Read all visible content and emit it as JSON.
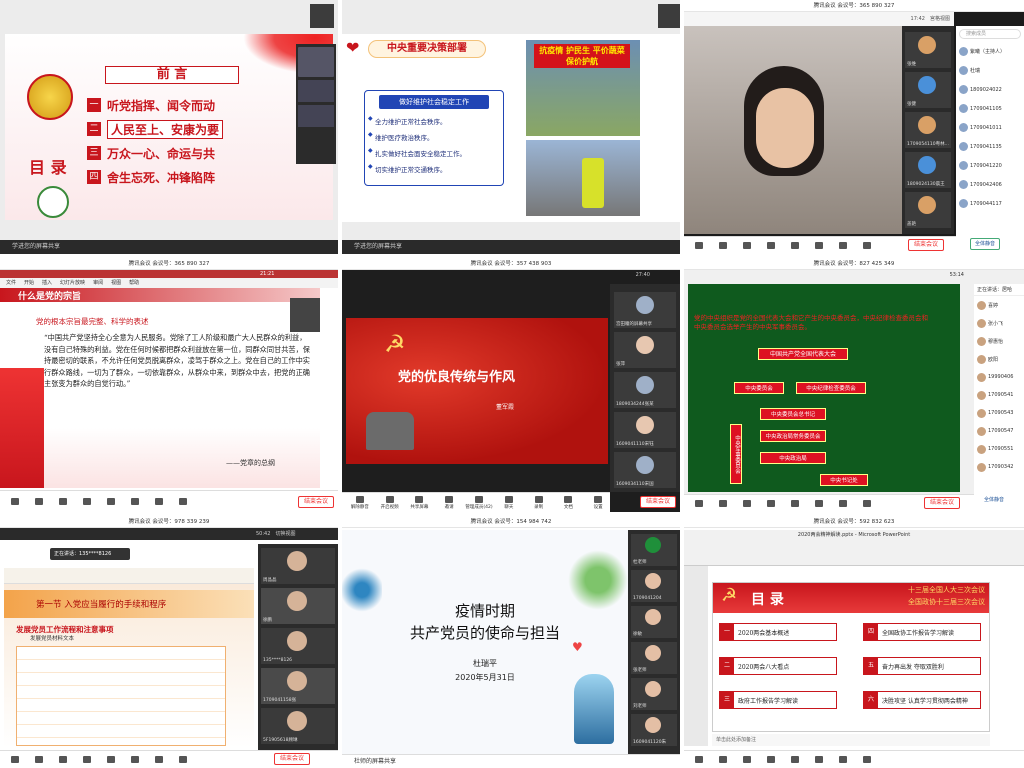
{
  "p1": {
    "heading": "前  言",
    "label": "目 录",
    "items": [
      {
        "num": "一",
        "text": "听党指挥、闻令而动"
      },
      {
        "num": "二",
        "text": "人民至上、安康为要"
      },
      {
        "num": "三",
        "text": "万众一心、命运与共"
      },
      {
        "num": "四",
        "text": "舍生忘死、冲锋陷阵"
      }
    ],
    "footer": "学进您的屏幕共享"
  },
  "p2": {
    "title": "中央重要决策部署",
    "box_title": "做好维护社会稳定工作",
    "items": [
      "全力维护正常社会秩序。",
      "维护医疗救治秩序。",
      "扎实做好社会面安全稳定工作。",
      "切实维护正常交通秩序。"
    ],
    "photo_text": "抗疫情 护民生 平价蔬菜 保价护航",
    "footer": "学进您的屏幕共享"
  },
  "p3": {
    "header": "腾讯会议 会议号：365 890 327",
    "time": "17:42",
    "view_label": "宫格视图",
    "search": "搜索成员",
    "participants": [
      "张维",
      "张健",
      "1709054110粤林...",
      "1809024130晨王",
      "盖艳"
    ],
    "list": [
      "紫曦（主持人）",
      "杜瑞",
      "1809024022",
      "1709041105",
      "1709041011",
      "1709041135",
      "1709041220",
      "1709042406",
      "1709044117"
    ],
    "leave": "结束会议",
    "invite": "全体静音"
  },
  "p4": {
    "header": "腾讯会议 会议号：365 890 327",
    "time": "21:21",
    "title": "什么是党的宗旨",
    "subtitle": "党的根本宗旨最完整、科学的表述",
    "quote": "“中国共产党坚持全心全意为人民服务。党除了工人阶级和最广大人民群众的利益，没有自己特殊的利益。党在任何时候都把群众利益放在第一位，同群众同甘共苦，保持最密切的联系，不允许任何党员脱离群众，凌驾于群众之上。党在自己的工作中实行群众路线，一切为了群众，一切依靠群众，从群众中来，到群众中去，把党的正确主张变为群众的自觉行动。”",
    "source": "——党章的总纲",
    "leave": "结束会议",
    "tabs": [
      "文件",
      "开始",
      "插入",
      "幻灯片放映",
      "审阅",
      "视图",
      "帮助"
    ]
  },
  "p5": {
    "header": "腾讯会议 会议号：357 438 903",
    "time": "27:40",
    "title": "党的优良传统与作风",
    "presenter": "董军霞",
    "participants": [
      "宫田瞳的屏幕共享",
      "张萍",
      "1809034244张某",
      "1609041110宋钰",
      "1609034110宋国"
    ],
    "leave": "结束会议",
    "tools": [
      "解除静音",
      "开启视频",
      "共享屏幕",
      "邀请",
      "管理成员(42)",
      "聊天",
      "录制",
      "文档",
      "设置"
    ]
  },
  "p6": {
    "header": "腾讯会议 会议号：827 425 349",
    "time": "53:14",
    "intro": "党的中央组织是党的全国代表大会和它产生的中央委员会，中央纪律检查委员会和中央委员会选举产生的中央军事委员会。",
    "top": "中国共产党全国代表大会",
    "mid": [
      "中央委员会",
      "中央纪律检查委员会"
    ],
    "chain": [
      "中央委员会总书记",
      "中央政治局常务委员会",
      "中央政治局",
      "中央书记处"
    ],
    "side": "中央军事委员会",
    "speaker": "正在讲话：居哈",
    "list": [
      "喜婷",
      "张小飞",
      "穆惠怡",
      "欧阳",
      "19990406",
      "17090541",
      "17090543",
      "17090547",
      "17090551",
      "17090342"
    ],
    "leave": "结束会议",
    "invite": "全体静音"
  },
  "p7": {
    "header": "腾讯会议 会议号：978 339 239",
    "time": "50:42",
    "speaker": "正在讲话：135****8126",
    "section": "第一节  入党应当履行的手续和程序",
    "sub": "发展党员工作流程和注意事项",
    "sub2": "发展党员材料文本",
    "participants": [
      "周晶晶",
      "徐鹏",
      "135****8126",
      "1709041158张",
      "5F1905618顾琳"
    ],
    "leave": "结束会议",
    "view": "切换视图"
  },
  "p8": {
    "header": "腾讯会议 会议号：154 984 742",
    "title1": "疫情时期",
    "title2": "共产党员的使命与担当",
    "author": "杜瑞平",
    "date": "2020年5月31日",
    "participants": [
      "杜老师",
      "1709041204",
      "徐敏",
      "张老师",
      "刘老师",
      "1609041120朱"
    ],
    "footer": "杜师的屏幕共享",
    "tag": "老师"
  },
  "p9": {
    "header": "腾讯会议 会议号：592 832 623",
    "app": "2020两会精神解读.pptx - Microsoft PowerPoint",
    "title": "目 录",
    "banner1": "十三届全国人大三次会议",
    "banner2": "全国政协十三届三次会议",
    "left": [
      {
        "n": "一",
        "t": "2020两会基本概述"
      },
      {
        "n": "二",
        "t": "2020两会八大看点"
      },
      {
        "n": "三",
        "t": "政府工作报告学习解读"
      }
    ],
    "right": [
      {
        "n": "四",
        "t": "全国政协工作报告学习解读"
      },
      {
        "n": "五",
        "t": "奋力再出发 夺取双胜利"
      },
      {
        "n": "六",
        "t": "决胜攻坚 认真学习贯彻两会精神"
      }
    ],
    "note": "单击此处添加备注"
  },
  "colors": {
    "party_red": "#c8161d",
    "gold": "#ffd966",
    "meeting_blue": "#1f6fff"
  }
}
